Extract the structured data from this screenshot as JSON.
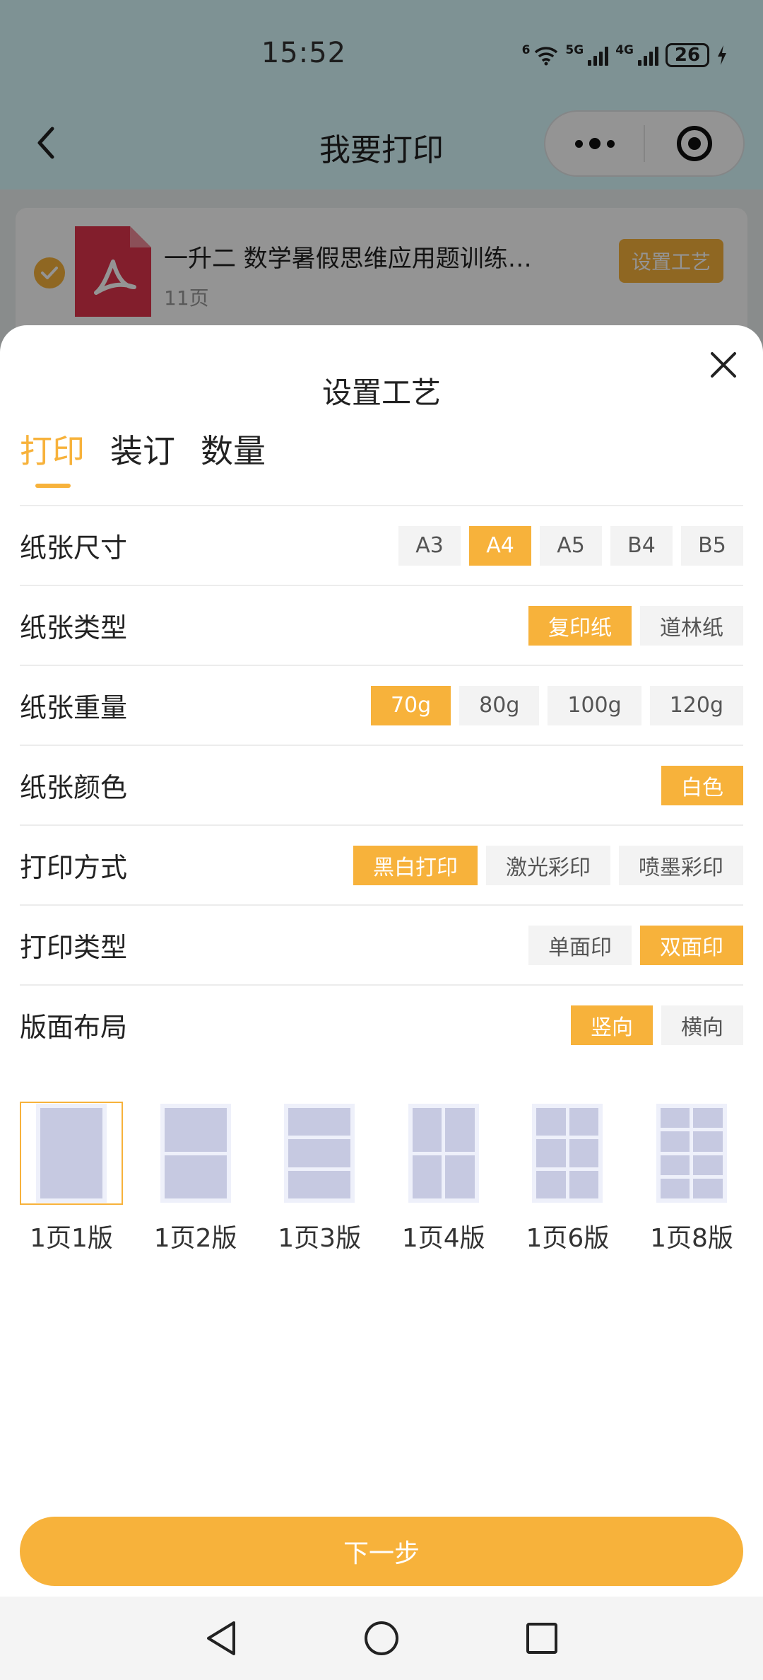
{
  "status_bar": {
    "time": "15:52",
    "wifi_label": "6",
    "signal1": "5G",
    "signal2": "4G",
    "battery": "26"
  },
  "nav": {
    "title": "我要打印",
    "back_icon": "chevron-left-icon",
    "more_icon": "more-dots-icon",
    "target_icon": "target-icon"
  },
  "file": {
    "name": "一升二 数学暑假思维应用题训练…",
    "pages": "11页",
    "action": "设置工艺",
    "selected": true,
    "icon": "pdf-icon"
  },
  "sheet": {
    "title": "设置工艺",
    "tabs": [
      {
        "label": "打印",
        "active": true
      },
      {
        "label": "装订",
        "active": false
      },
      {
        "label": "数量",
        "active": false
      }
    ],
    "options": [
      {
        "label": "纸张尺寸",
        "choices": [
          "A3",
          "A4",
          "A5",
          "B4",
          "B5"
        ],
        "selected": 1
      },
      {
        "label": "纸张类型",
        "choices": [
          "复印纸",
          "道林纸"
        ],
        "selected": 0
      },
      {
        "label": "纸张重量",
        "choices": [
          "70g",
          "80g",
          "100g",
          "120g"
        ],
        "selected": 0
      },
      {
        "label": "纸张颜色",
        "choices": [
          "白色"
        ],
        "selected": 0
      },
      {
        "label": "打印方式",
        "choices": [
          "黑白打印",
          "激光彩印",
          "喷墨彩印"
        ],
        "selected": 0
      },
      {
        "label": "打印类型",
        "choices": [
          "单面印",
          "双面印"
        ],
        "selected": 1
      },
      {
        "label": "版面布局",
        "choices": [
          "竖向",
          "横向"
        ],
        "selected": 0
      }
    ],
    "layouts": [
      {
        "label": "1页1版",
        "cols": 1,
        "rows": 1,
        "selected": true
      },
      {
        "label": "1页2版",
        "cols": 1,
        "rows": 2,
        "selected": false
      },
      {
        "label": "1页3版",
        "cols": 1,
        "rows": 3,
        "selected": false
      },
      {
        "label": "1页4版",
        "cols": 2,
        "rows": 2,
        "selected": false
      },
      {
        "label": "1页6版",
        "cols": 2,
        "rows": 3,
        "selected": false
      },
      {
        "label": "1页8版",
        "cols": 2,
        "rows": 4,
        "selected": false
      }
    ],
    "next_button": "下一步"
  },
  "colors": {
    "accent": "#f7b23b",
    "header_bg": "#d9fbff",
    "chip_bg": "#f3f3f3"
  }
}
